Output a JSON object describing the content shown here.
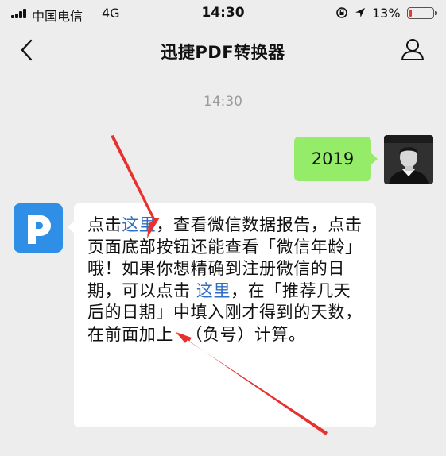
{
  "status_bar": {
    "carrier": "中国电信",
    "network": "4G",
    "time": "14:30",
    "battery_percent": "13%",
    "battery_level": 0.13
  },
  "nav": {
    "title": "迅捷PDF转换器",
    "back_icon": "chevron-left-icon",
    "profile_icon": "user-icon"
  },
  "chat": {
    "timestamp": "14:30",
    "outgoing_message": "2019",
    "incoming": {
      "part1": "点击",
      "link1": "这里",
      "part2": "，查看微信数据报告，点击页面底部按钮还能查看「微信年龄」哦！如果你想精确到注册微信的日期，可以点击 ",
      "link2": "这里",
      "part3": "，在「推荐几天后的日期」中填入刚才得到的天数，在前面加上 -（负号）计算。"
    }
  },
  "colors": {
    "background": "#ededed",
    "outgoing_bubble": "#95ec69",
    "link": "#2f6fc1",
    "annotation_arrow": "#e8312f",
    "app_icon": "#2f8fe6"
  }
}
